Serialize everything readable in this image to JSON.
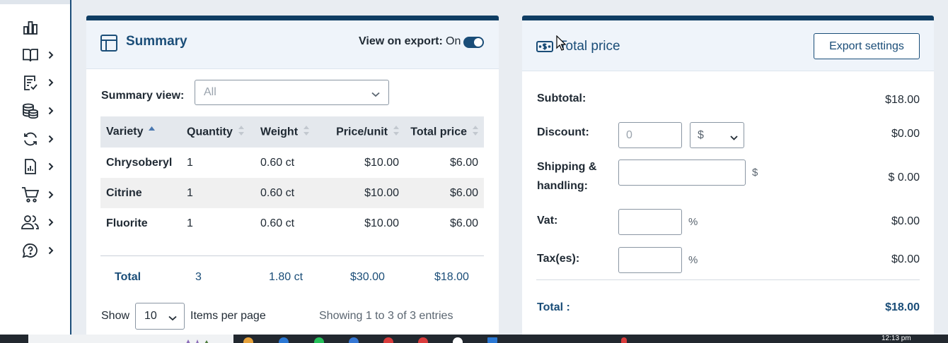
{
  "sidebar": {
    "items": [
      {
        "icon": "chart-bars-icon",
        "has_chevron": false
      },
      {
        "icon": "book-open-icon",
        "has_chevron": true
      },
      {
        "icon": "checklist-icon",
        "has_chevron": true
      },
      {
        "icon": "coins-stack-icon",
        "has_chevron": true
      },
      {
        "icon": "refresh-icon",
        "has_chevron": true
      },
      {
        "icon": "report-icon",
        "has_chevron": true
      },
      {
        "icon": "shopping-cart-icon",
        "has_chevron": true
      },
      {
        "icon": "users-icon",
        "has_chevron": true
      },
      {
        "icon": "help-icon",
        "has_chevron": true
      }
    ]
  },
  "summary": {
    "title": "Summary",
    "view_on_export_label": "View on export:",
    "view_on_export_state": "On",
    "summary_view_label": "Summary view:",
    "summary_view_value": "All",
    "columns": [
      "Variety",
      "Quantity",
      "Weight",
      "Price/unit",
      "Total price"
    ],
    "rows": [
      {
        "variety": "Chrysoberyl",
        "quantity": "1",
        "weight": "0.60 ct",
        "price_unit": "$10.00",
        "total": "$6.00"
      },
      {
        "variety": "Citrine",
        "quantity": "1",
        "weight": "0.60 ct",
        "price_unit": "$10.00",
        "total": "$6.00"
      },
      {
        "variety": "Fluorite",
        "quantity": "1",
        "weight": "0.60 ct",
        "price_unit": "$10.00",
        "total": "$6.00"
      }
    ],
    "totals": {
      "label": "Total",
      "quantity": "3",
      "weight": "1.80 ct",
      "price_unit": "$30.00",
      "total": "$18.00"
    },
    "show_label": "Show",
    "per_page_value": "10",
    "items_per_page_label": "Items per page",
    "entries_text": "Showing 1 to 3 of 3 entries"
  },
  "price": {
    "title": "Total price",
    "export_button": "Export settings",
    "subtotal_label": "Subtotal:",
    "subtotal_value": "$18.00",
    "discount_label": "Discount:",
    "discount_placeholder": "0",
    "discount_currency": "$",
    "discount_value": "$0.00",
    "shipping_label_1": "Shipping &",
    "shipping_label_2": "handling:",
    "shipping_unit": "$",
    "shipping_value": "$ 0.00",
    "vat_label": "Vat:",
    "vat_unit": "%",
    "vat_value": "$0.00",
    "taxes_label": "Tax(es):",
    "taxes_unit": "%",
    "taxes_value": "$0.00",
    "grand_total_label": "Total :",
    "grand_total_value": "$18.00"
  },
  "taskbar": {
    "time": "12:13 pm"
  },
  "colors": {
    "brand_dark": "#0f3d63",
    "brand": "#1a4d78",
    "header_bg": "#eff4fa",
    "table_header_bg": "#e4e8ed"
  }
}
